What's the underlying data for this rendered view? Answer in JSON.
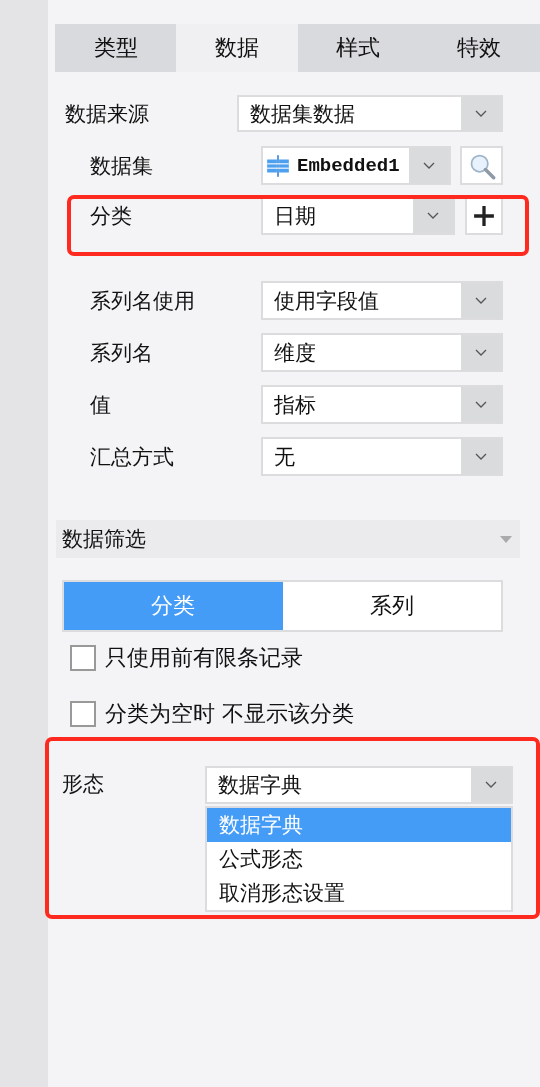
{
  "tabs": [
    {
      "label": "类型",
      "selected": false
    },
    {
      "label": "数据",
      "selected": true
    },
    {
      "label": "样式",
      "selected": false
    },
    {
      "label": "特效",
      "selected": false
    }
  ],
  "data_source": {
    "label": "数据来源",
    "value": "数据集数据"
  },
  "dataset": {
    "label": "数据集",
    "value": "Embedded1"
  },
  "category": {
    "label": "分类",
    "value": "日期"
  },
  "series_fields": [
    {
      "label": "系列名使用",
      "value": "使用字段值"
    },
    {
      "label": "系列名",
      "value": "维度"
    },
    {
      "label": "值",
      "value": "指标"
    },
    {
      "label": "汇总方式",
      "value": "无"
    }
  ],
  "filter_section": {
    "title": "数据筛选",
    "segments": [
      {
        "label": "分类",
        "selected": true
      },
      {
        "label": "系列",
        "selected": false
      }
    ],
    "checkboxes": [
      {
        "label": "只使用前有限条记录",
        "checked": false
      },
      {
        "label": "分类为空时 不显示该分类",
        "checked": false
      }
    ]
  },
  "form": {
    "label": "形态",
    "value": "数据字典",
    "options": [
      {
        "label": "数据字典",
        "selected": true
      },
      {
        "label": "公式形态",
        "selected": false
      },
      {
        "label": "取消形态设置",
        "selected": false
      }
    ]
  }
}
